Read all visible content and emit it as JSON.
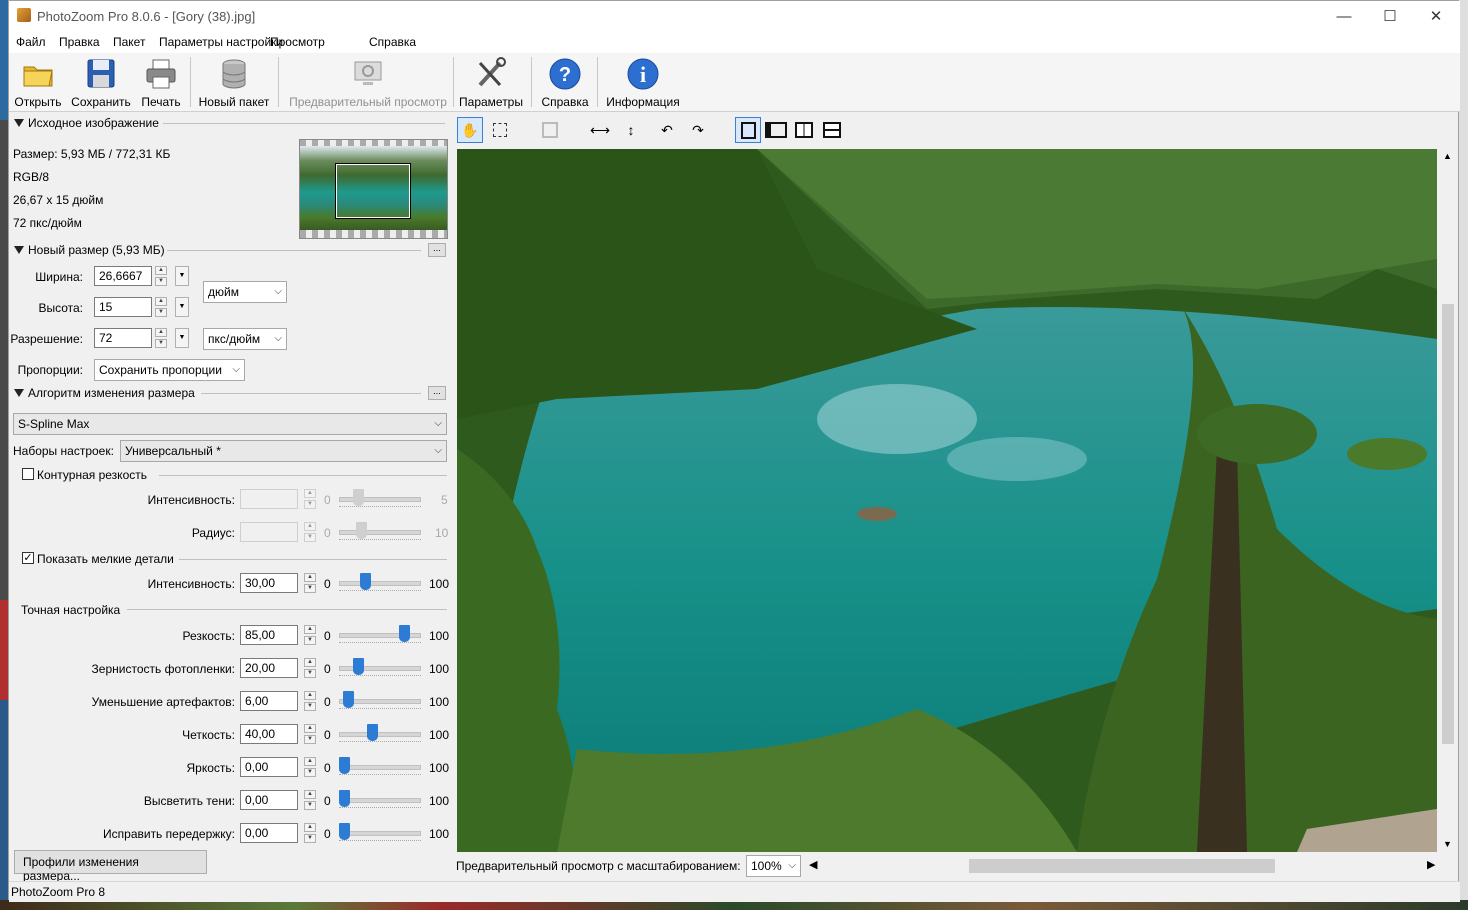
{
  "window": {
    "title": "PhotoZoom Pro 8.0.6 - [Gory (38).jpg]",
    "minimize": "—",
    "maximize": "☐",
    "close": "✕"
  },
  "menu": [
    "Файл",
    "Правка",
    "Пакет",
    "Параметры настройки",
    "Просмотр",
    "Справка"
  ],
  "toolbar": {
    "open": "Открыть",
    "save": "Сохранить",
    "print": "Печать",
    "new_batch": "Новый пакет",
    "preview": "Предварительный просмотр",
    "settings": "Параметры",
    "help": "Справка",
    "info": "Информация"
  },
  "source": {
    "header": "Исходное изображение",
    "size": "Размер: 5,93 МБ / 772,31 КБ",
    "mode": "RGB/8",
    "dimensions": "26,67 x 15 дюйм",
    "resolution": "72 пкс/дюйм"
  },
  "new_size": {
    "header": "Новый размер (5,93 МБ)",
    "more": "...",
    "width_label": "Ширина:",
    "width_value": "26,6667",
    "height_label": "Высота:",
    "height_value": "15",
    "resolution_label": "Разрешение:",
    "resolution_value": "72",
    "unit": "дюйм",
    "res_unit": "пкс/дюйм",
    "proportions_label": "Пропорции:",
    "proportions_value": "Сохранить пропорции"
  },
  "algorithm": {
    "header": "Алгоритм изменения размера",
    "more": "...",
    "method": "S-Spline Max",
    "presets_label": "Наборы настроек:",
    "presets_value": "Универсальный *"
  },
  "contour": {
    "label": "Контурная резкость",
    "checked": false,
    "intensity_label": "Интенсивность:",
    "intensity_min": "0",
    "intensity_max": "5",
    "radius_label": "Радиус:",
    "radius_min": "0",
    "radius_max": "10"
  },
  "details": {
    "label": "Показать мелкие детали",
    "checked": true,
    "check_mark": "✓",
    "intensity_label": "Интенсивность:",
    "intensity_value": "30,00",
    "min": "0",
    "max": "100"
  },
  "fine": {
    "header": "Точная настройка",
    "rows": [
      {
        "label": "Резкость:",
        "value": "85,00",
        "level": 85,
        "min": "0",
        "max": "100"
      },
      {
        "label": "Зернистость фотопленки:",
        "value": "20,00",
        "level": 20,
        "min": "0",
        "max": "100"
      },
      {
        "label": "Уменьшение артефактов:",
        "value": "6,00",
        "level": 6,
        "min": "0",
        "max": "100"
      },
      {
        "label": "Четкость:",
        "value": "40,00",
        "level": 40,
        "min": "0",
        "max": "100"
      },
      {
        "label": "Яркость:",
        "value": "0,00",
        "level": 0,
        "min": "0",
        "max": "100"
      },
      {
        "label": "Высветить тени:",
        "value": "0,00",
        "level": 0,
        "min": "0",
        "max": "100"
      },
      {
        "label": "Исправить передержку:",
        "value": "0,00",
        "level": 0,
        "min": "0",
        "max": "100"
      }
    ]
  },
  "profiles_button": "Профили изменения размера...",
  "preview_bar": {
    "label": "Предварительный просмотр с масштабированием:",
    "zoom": "100%"
  },
  "status": "PhotoZoom Pro 8",
  "colors": {
    "accent": "#2c7cd6",
    "water": "#1a8a82",
    "forest": "#2f5a1e"
  }
}
